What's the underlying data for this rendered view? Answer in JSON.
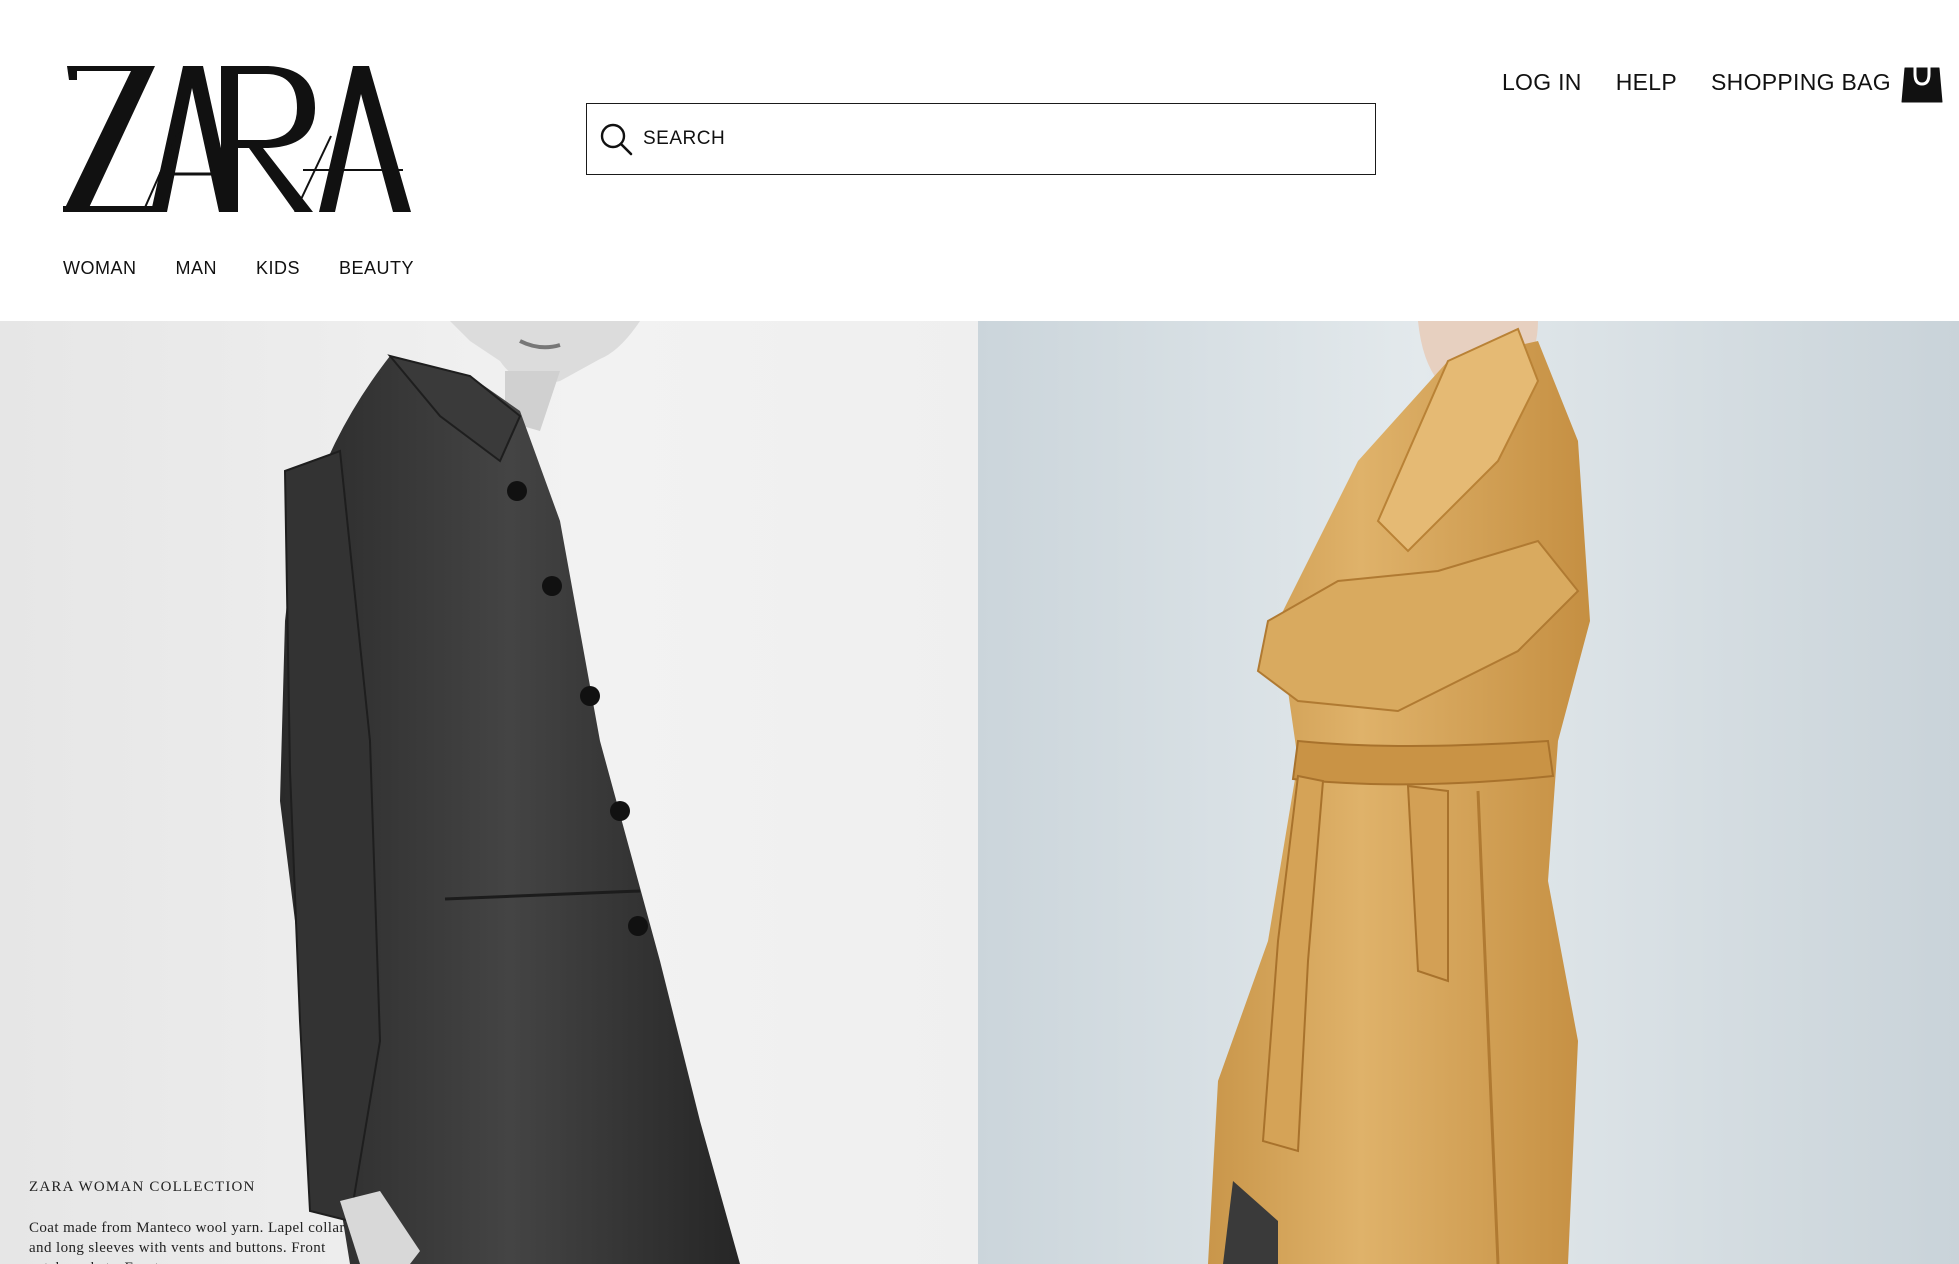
{
  "brand": {
    "name": "ZARA"
  },
  "search": {
    "placeholder": "SEARCH",
    "value": ""
  },
  "account_nav": [
    {
      "label": "LOG IN"
    },
    {
      "label": "HELP"
    },
    {
      "label": "SHOPPING BAG"
    }
  ],
  "categories": [
    {
      "label": "WOMAN"
    },
    {
      "label": "MAN"
    },
    {
      "label": "KIDS"
    },
    {
      "label": "BEAUTY"
    }
  ],
  "hero": {
    "left": {
      "caption_title": "ZARA WOMAN COLLECTION",
      "caption_text": "Coat made from Manteco wool yarn. Lapel collar and long sleeves with vents and buttons. Front patch pockets. Front"
    }
  },
  "icons": {
    "search": "search-icon",
    "bag": "shopping-bag-icon"
  },
  "colors": {
    "text": "#111111",
    "background": "#ffffff",
    "left_panel": "#f0f0f0",
    "right_panel": "#d8e0e5",
    "camel_coat": "#d9a95c"
  }
}
